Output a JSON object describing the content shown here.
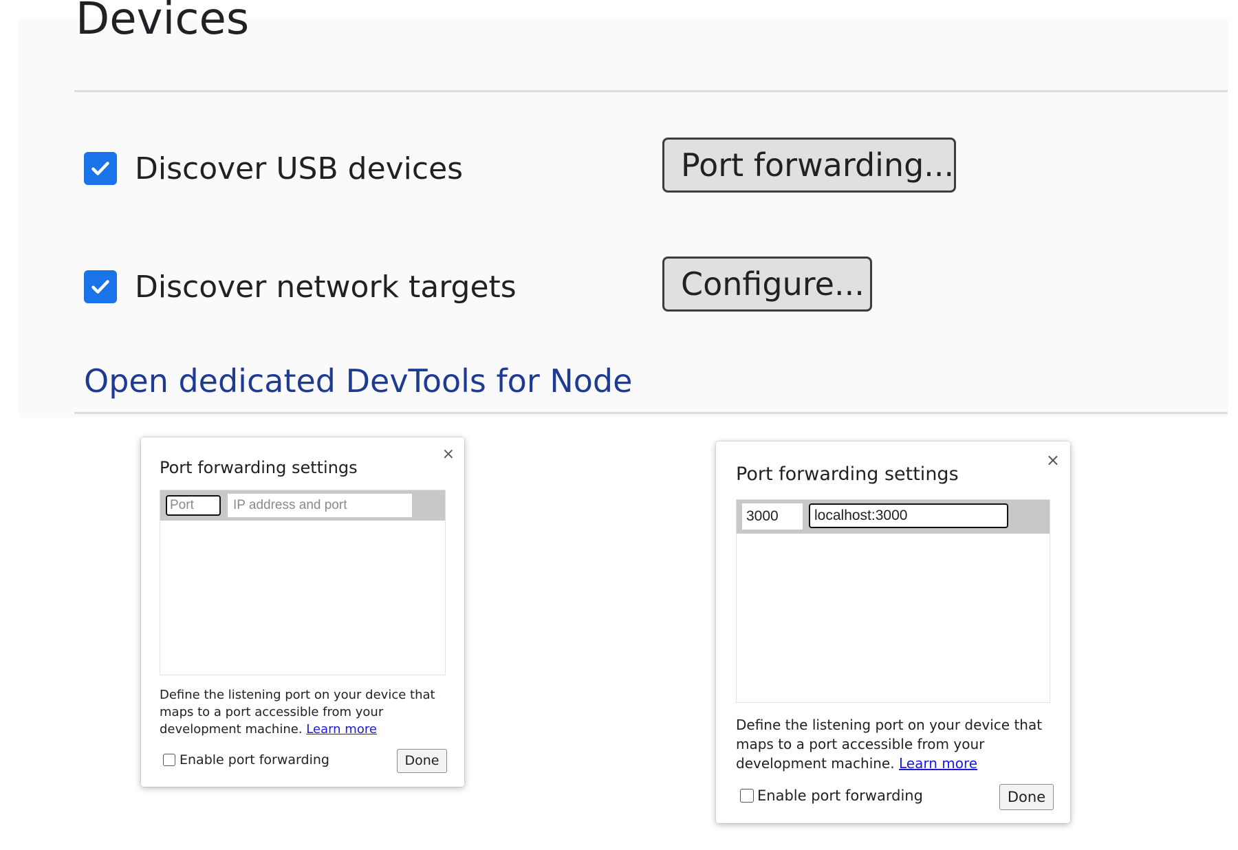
{
  "devices": {
    "title": "Devices",
    "discover_usb": {
      "label": "Discover USB devices",
      "checked": true
    },
    "port_forwarding_button": "Port forwarding...",
    "discover_network": {
      "label": "Discover network targets",
      "checked": true
    },
    "configure_button": "Configure...",
    "node_link": "Open dedicated DevTools for Node",
    "accent_color": "#1a73e8"
  },
  "dialog_empty": {
    "title": "Port forwarding settings",
    "close": "×",
    "port_placeholder": "Port",
    "port_value": "",
    "address_placeholder": "IP address and port",
    "address_value": "",
    "description": "Define the listening port on your device that maps to a port accessible from your development machine.",
    "learn_more": "Learn more",
    "enable_label": "Enable port forwarding",
    "enable_checked": false,
    "done": "Done"
  },
  "dialog_filled": {
    "title": "Port forwarding settings",
    "close": "×",
    "port_value": "3000",
    "address_value": "localhost:3000",
    "description": "Define the listening port on your device that maps to a port accessible from your development machine.",
    "learn_more": "Learn more",
    "enable_label": "Enable port forwarding",
    "enable_checked": false,
    "done": "Done"
  }
}
